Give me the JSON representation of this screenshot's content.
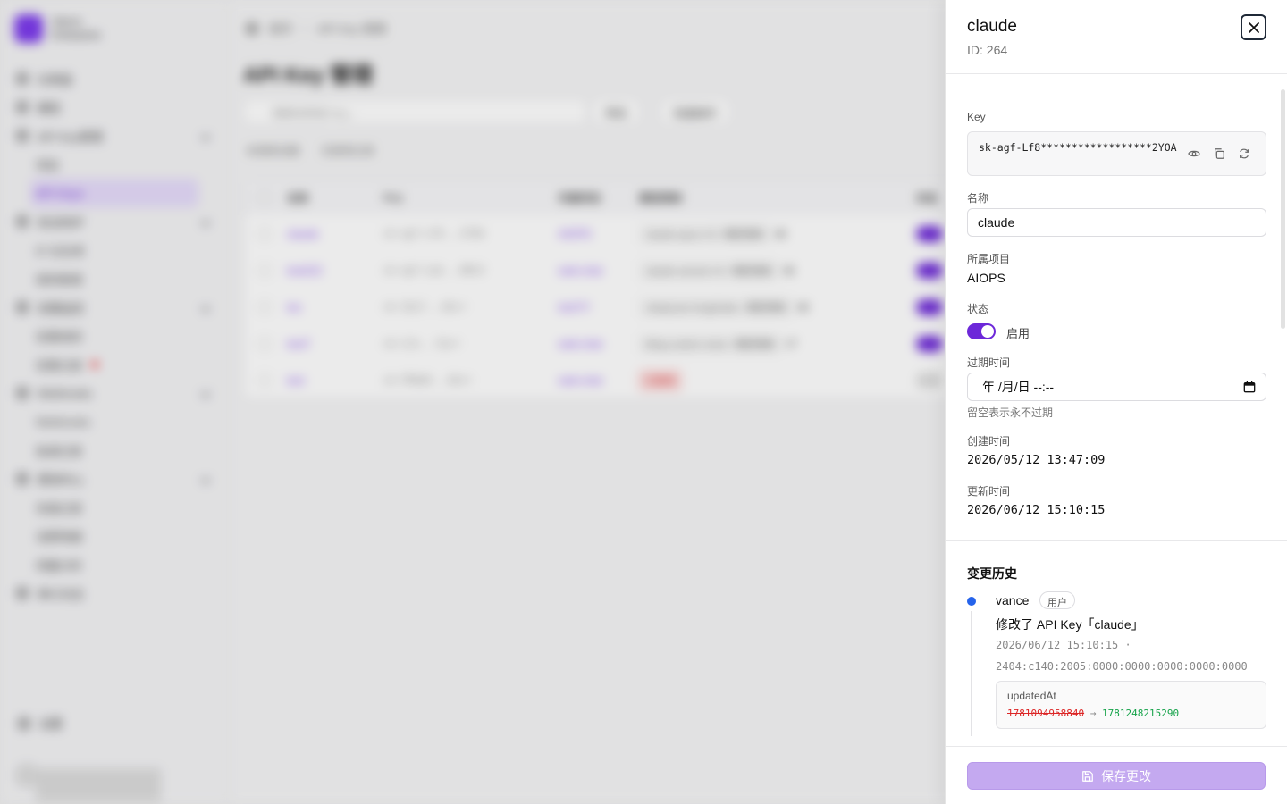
{
  "brand": {
    "name": "Vance",
    "edition": "Enterprise"
  },
  "nav": {
    "items": [
      {
        "label": "仪表盘",
        "level": "top"
      },
      {
        "label": "模型",
        "level": "top"
      },
      {
        "label": "API Key管理",
        "level": "top"
      },
      {
        "label": "项目",
        "level": "sub"
      },
      {
        "label": "API Keys",
        "level": "active"
      },
      {
        "label": "安全防护",
        "level": "top"
      },
      {
        "label": "IP 白名单",
        "level": "sub"
      },
      {
        "label": "规则管理",
        "level": "sub"
      },
      {
        "label": "告警监控",
        "level": "top"
      },
      {
        "label": "告警规则",
        "level": "sub"
      },
      {
        "label": "告警记录",
        "level": "sub"
      },
      {
        "label": "Webhooks",
        "level": "top"
      },
      {
        "label": "Webhooks",
        "level": "sub"
      },
      {
        "label": "投递记录",
        "level": "sub"
      },
      {
        "label": "费用中心",
        "level": "top"
      },
      {
        "label": "充值记录",
        "level": "sub"
      },
      {
        "label": "消费明细",
        "level": "sub"
      },
      {
        "label": "用量分析",
        "level": "sub"
      },
      {
        "label": "审计日志",
        "level": "top"
      }
    ],
    "settings_label": "设置",
    "user_label": "vance"
  },
  "main": {
    "breadcrumb": [
      "首页",
      "API Key 管理"
    ],
    "title": "API Key 管理",
    "search_placeholder": "搜索名称或 Key...",
    "btn_filter": "筛选",
    "btn_batch": "批量操作",
    "filters": [
      "本周新创建",
      "无使用记录"
    ],
    "columns": [
      "名称",
      "Key",
      "所属项目",
      "模型限制",
      "状态"
    ],
    "rows": [
      {
        "name": "claude",
        "key": "sk-agf-Lf8...2YOA",
        "project": "AIOPS",
        "limit": "claude-opus-4-6 / 模型限制",
        "extra": "+8",
        "enabled": true
      },
      {
        "name": "test222",
        "key": "sk-agf-Lab...8Kh3",
        "project": "web-chat",
        "limit": "claude-sonnet-4-6 / 模型限制",
        "extra": "+8",
        "enabled": true
      },
      {
        "name": "tes",
        "key": "sk-1Ey7...Ab+r",
        "project": "testYY",
        "limit": "robopt-pro-long/index / 模型限制",
        "extra": "+8",
        "enabled": true
      },
      {
        "name": "test7",
        "key": "sk-L3x...Yp+r",
        "project": "web-chat",
        "limit": "bling-custom-voice / 模型限制",
        "extra": "+7",
        "enabled": true
      },
      {
        "name": "test",
        "key": "sk-FR8aR...Ab+r",
        "project": "web-chat",
        "limit": "已禁用",
        "extra": "",
        "enabled": false
      }
    ]
  },
  "drawer": {
    "title": "claude",
    "id_text": "ID: 264",
    "key_label": "Key",
    "key_value": "sk-agf-Lf8******************2YOA",
    "name_label": "名称",
    "name_value": "claude",
    "project_label": "所属项目",
    "project_value": "AIOPS",
    "status_label": "状态",
    "status_value": "启用",
    "status_enabled": true,
    "expire_label": "过期时间",
    "expire_placeholder": "年 /月/日 --:--",
    "expire_hint": "留空表示永不过期",
    "created_label": "创建时间",
    "created_value": "2026/05/12 13:47:09",
    "updated_label": "更新时间",
    "updated_value": "2026/06/12 15:10:15",
    "history_title": "变更历史",
    "history": [
      {
        "user": "vance",
        "badge": "用户",
        "action": "修改了 API Key「claude」",
        "time": "2026/06/12 15:10:15 ·",
        "ip": "2404:c140:2005:0000:0000:0000:0000:0000",
        "field": "updatedAt",
        "old": "1781094958840",
        "arrow": "→",
        "new": "1781248215290"
      }
    ],
    "save_label": "保存更改"
  },
  "colors": {
    "accent": "#6d28d9",
    "save_disabled": "#c4a9f0",
    "timeline_dot": "#2563eb",
    "diff_old": "#dc2626",
    "diff_new": "#16a34a"
  }
}
